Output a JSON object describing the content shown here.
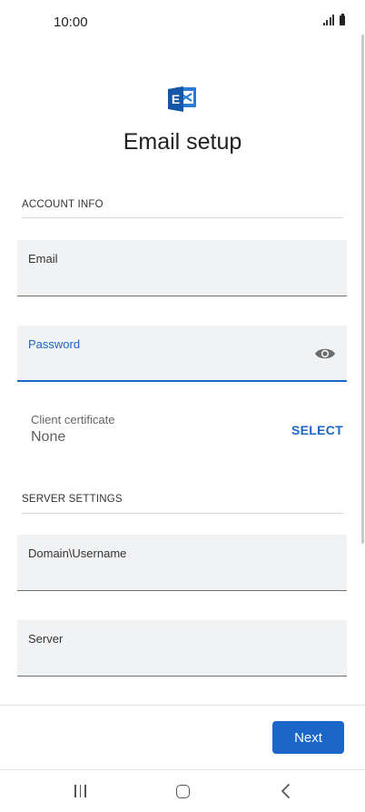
{
  "status_bar": {
    "time": "10:00"
  },
  "header": {
    "title": "Email setup",
    "logo_icon": "exchange-logo-icon"
  },
  "account_info": {
    "section_label": "ACCOUNT INFO",
    "email": {
      "label": "Email",
      "value": ""
    },
    "password": {
      "label": "Password",
      "value": "",
      "reveal_icon": "eye-icon"
    },
    "client_certificate": {
      "label": "Client certificate",
      "value": "None",
      "action": "SELECT"
    }
  },
  "server_settings": {
    "section_label": "SERVER SETTINGS",
    "domain_username": {
      "label": "Domain\\Username",
      "value": ""
    },
    "server": {
      "label": "Server",
      "value": ""
    }
  },
  "footer": {
    "next_label": "Next"
  },
  "colors": {
    "accent": "#1a66c9",
    "field_bg": "#f1f2f4"
  }
}
